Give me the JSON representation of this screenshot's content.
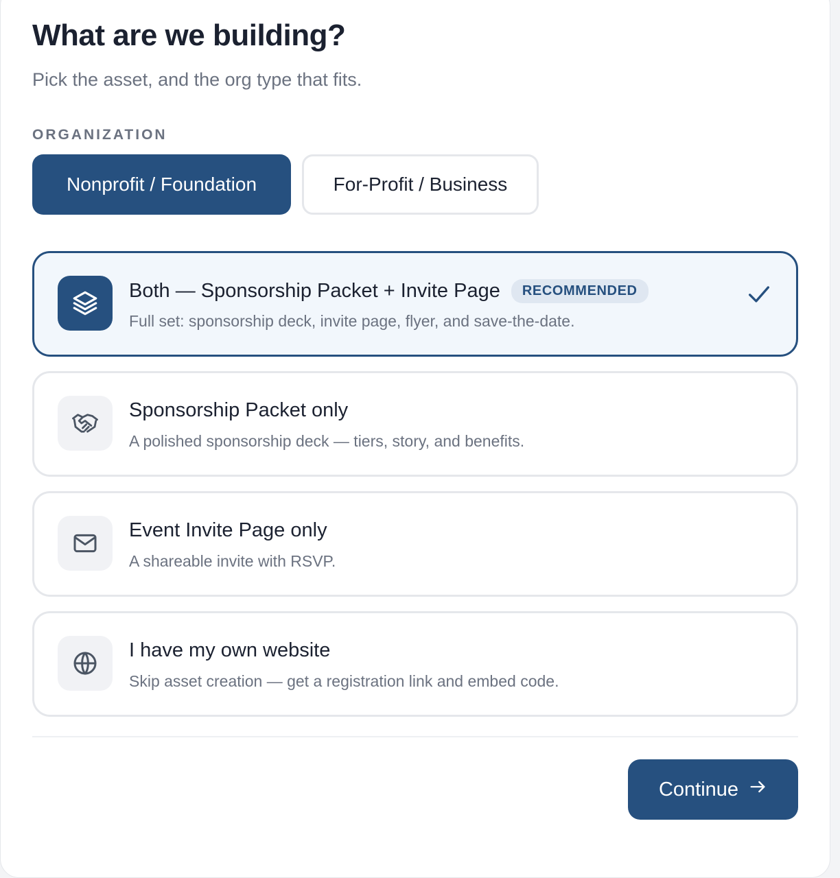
{
  "header": {
    "title": "What are we building?",
    "subtitle": "Pick the asset, and the org type that fits."
  },
  "organization": {
    "label": "ORGANIZATION",
    "options": [
      {
        "label": "Nonprofit / Foundation",
        "selected": true
      },
      {
        "label": "For-Profit / Business",
        "selected": false
      }
    ]
  },
  "assets": [
    {
      "icon": "layers-icon",
      "title": "Both — Sponsorship Packet + Invite Page",
      "badge": "RECOMMENDED",
      "description": "Full set: sponsorship deck, invite page, flyer, and save-the-date.",
      "selected": true
    },
    {
      "icon": "handshake-icon",
      "title": "Sponsorship Packet only",
      "description": "A polished sponsorship deck — tiers, story, and benefits.",
      "selected": false
    },
    {
      "icon": "envelope-icon",
      "title": "Event Invite Page only",
      "description": "A shareable invite with RSVP.",
      "selected": false
    },
    {
      "icon": "globe-icon",
      "title": "I have my own website",
      "description": "Skip asset creation — get a registration link and embed code.",
      "selected": false
    }
  ],
  "footer": {
    "continue_label": "Continue"
  },
  "colors": {
    "primary": "#26507f",
    "selected_bg": "#f2f7fc",
    "border": "#e5e7eb",
    "muted_text": "#6b7280"
  }
}
